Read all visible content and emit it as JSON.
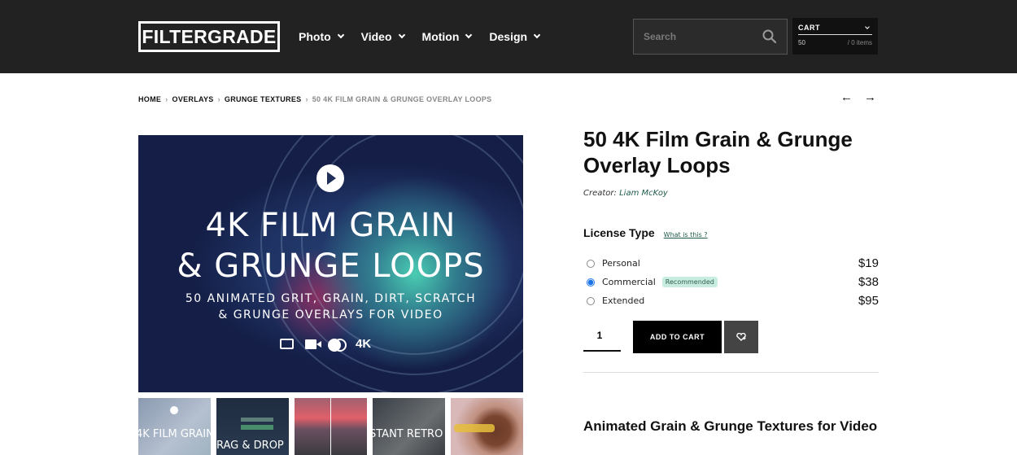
{
  "header": {
    "logo": "FILTERGRADE",
    "nav": [
      {
        "label": "Photo"
      },
      {
        "label": "Video"
      },
      {
        "label": "Motion"
      },
      {
        "label": "Design"
      }
    ],
    "search": {
      "placeholder": "Search",
      "value": ""
    },
    "cart": {
      "label": "CART",
      "total": "50",
      "items": "/ 0 items"
    }
  },
  "breadcrumb": {
    "items": [
      "HOME",
      "OVERLAYS",
      "GRUNGE TEXTURES"
    ],
    "current": "50 4K FILM GRAIN & GRUNGE OVERLAY LOOPS",
    "separator": "›"
  },
  "pager": {
    "prev": "←",
    "next": "→"
  },
  "hero": {
    "title_line1": "4K FILM GRAIN",
    "title_line2": "& GRUNGE LOOPS",
    "subtitle_line1": "50 ANIMATED GRIT, GRAIN, DIRT, SCRATCH",
    "subtitle_line2": "& GRUNGE OVERLAYS FOR VIDEO",
    "badges": [
      "loop-icon",
      "video-camera-icon",
      "blend-icon"
    ],
    "resolution": "4K"
  },
  "thumbnails": [
    {
      "label": "4K FILM GRAIN"
    },
    {
      "label": "RAG & DROP"
    },
    {
      "label": ""
    },
    {
      "label": "STANT RETRO"
    },
    {
      "label": ""
    }
  ],
  "product": {
    "title": "50 4K Film Grain & Grunge Overlay Loops",
    "creator_label": "Creator:",
    "creator_name": "Liam McKoy",
    "license_title": "License Type",
    "license_help": "What is this ?",
    "licenses": [
      {
        "label": "Personal",
        "price": "$19",
        "selected": false,
        "badge": ""
      },
      {
        "label": "Commercial",
        "price": "$38",
        "selected": true,
        "badge": "Recommended"
      },
      {
        "label": "Extended",
        "price": "$95",
        "selected": false,
        "badge": ""
      }
    ],
    "quantity": "1",
    "add_to_cart": "ADD TO CART",
    "description_title": "Animated Grain & Grunge Textures for Video"
  },
  "colors": {
    "header_bg": "#222222",
    "accent_link": "#1f5b4b",
    "badge_bg": "#c9ece0",
    "radio_selected": "#1a73e8"
  }
}
